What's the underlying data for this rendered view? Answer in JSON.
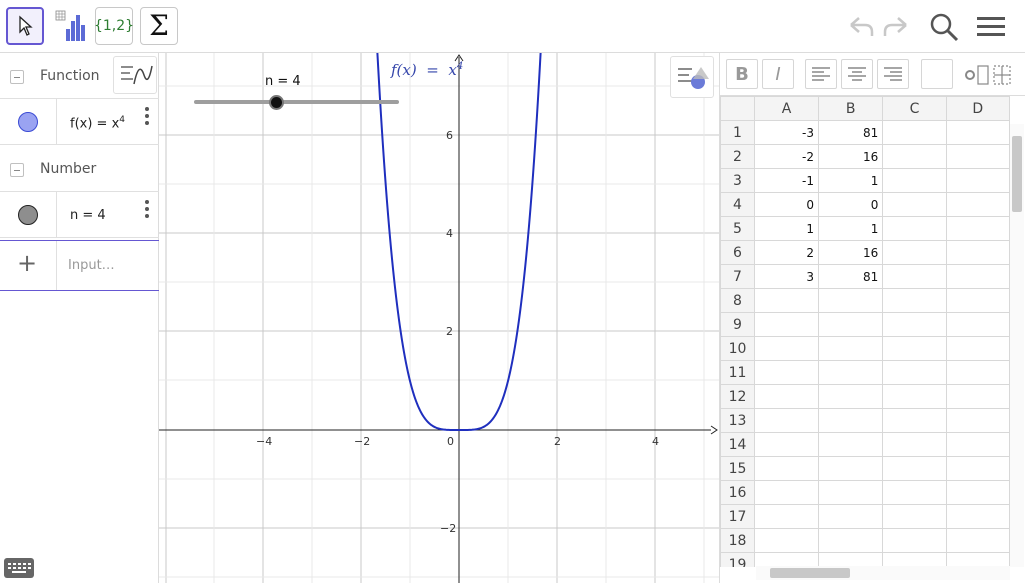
{
  "toolbar": {
    "tools": [
      {
        "name": "move",
        "icon": "arrow-pointer-icon",
        "active": true
      },
      {
        "name": "bar-chart",
        "icon": "bar-chart-icon"
      },
      {
        "name": "list",
        "label": "{1,2}"
      },
      {
        "name": "sum",
        "label": "Σ"
      }
    ],
    "right_icons": [
      "undo-icon",
      "redo-icon",
      "search-icon",
      "menu-icon"
    ]
  },
  "algebra": {
    "groups": [
      {
        "title": "Function",
        "items": [
          {
            "text": "f(x) = x",
            "sup": "4",
            "marble_color": "#9aa3f2"
          }
        ]
      },
      {
        "title": "Number",
        "items": [
          {
            "text": "n = 4",
            "marble_color": "#8e8e8e"
          }
        ]
      }
    ],
    "input_placeholder": "Input…"
  },
  "graphics": {
    "slider": {
      "label": "n = 4",
      "value": 4,
      "min": 1,
      "max": 10
    },
    "function_label": {
      "lhs": "f(x)",
      "eq": "=",
      "base": "x",
      "exp": "4"
    },
    "x_ticks": [
      "−4",
      "−2",
      "0",
      "2",
      "4"
    ],
    "y_ticks": [
      "6",
      "4",
      "2",
      "−2"
    ],
    "curve_color": "#1f2fbe"
  },
  "spreadsheet": {
    "columns": [
      "A",
      "B",
      "C",
      "D"
    ],
    "rows": [
      {
        "n": "1",
        "A": "-3",
        "B": "81"
      },
      {
        "n": "2",
        "A": "-2",
        "B": "16"
      },
      {
        "n": "3",
        "A": "-1",
        "B": "1"
      },
      {
        "n": "4",
        "A": "0",
        "B": "0"
      },
      {
        "n": "5",
        "A": "1",
        "B": "1"
      },
      {
        "n": "6",
        "A": "2",
        "B": "16"
      },
      {
        "n": "7",
        "A": "3",
        "B": "81"
      },
      {
        "n": "8"
      },
      {
        "n": "9"
      },
      {
        "n": "10"
      },
      {
        "n": "11"
      },
      {
        "n": "12"
      },
      {
        "n": "13"
      },
      {
        "n": "14"
      },
      {
        "n": "15"
      },
      {
        "n": "16"
      },
      {
        "n": "17"
      },
      {
        "n": "18"
      },
      {
        "n": "19"
      }
    ],
    "toolbar": {
      "bold": "B",
      "italic": "I"
    }
  }
}
